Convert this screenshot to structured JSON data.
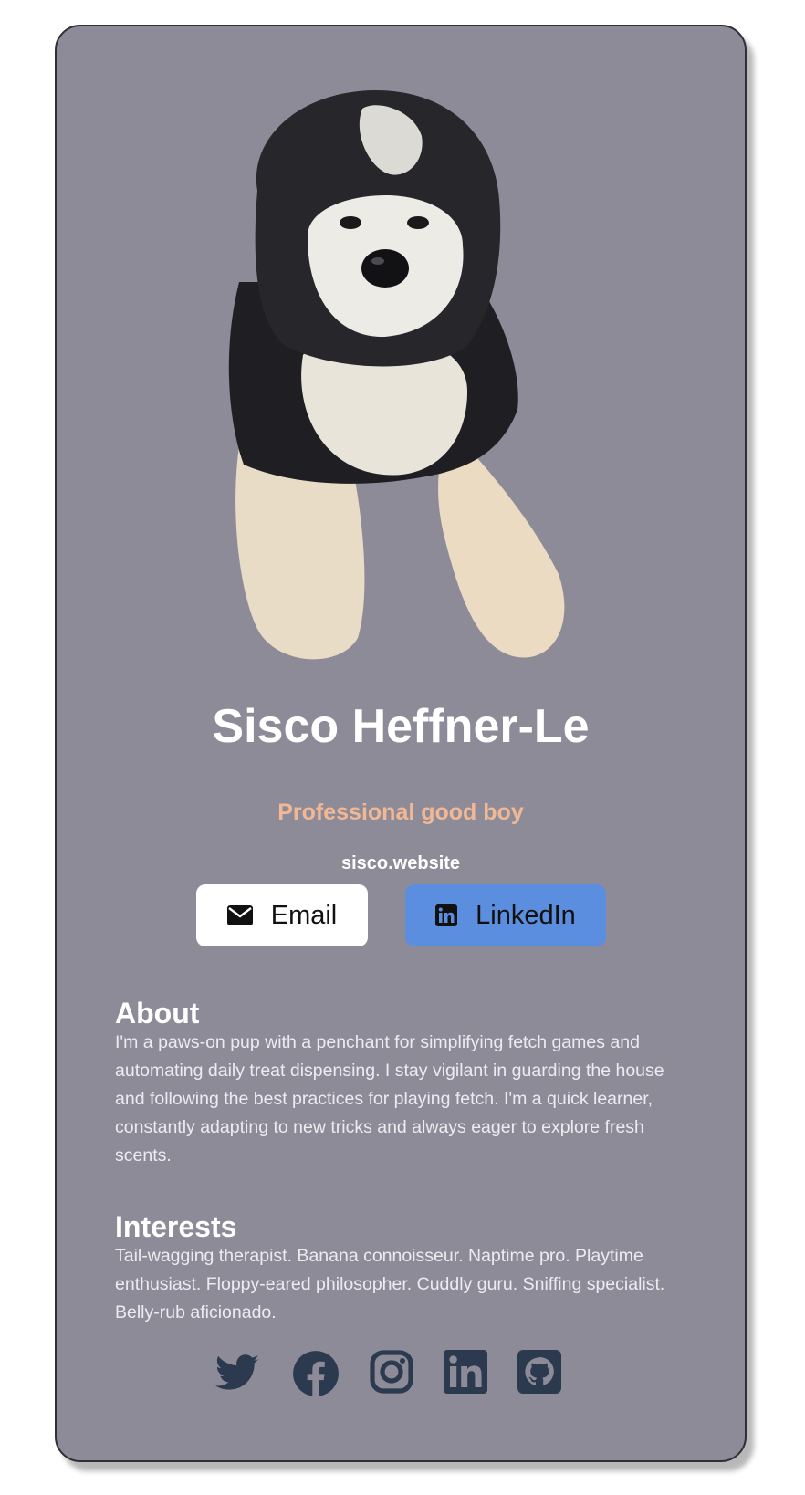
{
  "profile": {
    "name": "Sisco Heffner-Le",
    "tagline": "Professional good boy",
    "website": "sisco.website",
    "photo_alt": "dog-photo"
  },
  "buttons": {
    "email_label": "Email",
    "linkedin_label": "LinkedIn"
  },
  "about": {
    "title": "About",
    "text": "I'm a paws-on pup with a penchant for simplifying fetch games and automating daily treat dispensing. I stay vigilant in guarding the house and following the best practices for playing fetch. I'm a quick learner, constantly adapting to new tricks and always eager to explore fresh scents."
  },
  "interests": {
    "title": "Interests",
    "text": "Tail-wagging therapist. Banana connoisseur. Naptime pro. Playtime enthusiast. Floppy-eared philosopher. Cuddly guru. Sniffing specialist. Belly-rub aficionado."
  },
  "social": {
    "icons": [
      "twitter-icon",
      "facebook-icon",
      "instagram-icon",
      "linkedin-icon",
      "github-icon"
    ]
  },
  "colors": {
    "page_background": "#ffffff",
    "card_background": "#8e8b98",
    "card_border": "#2f2f35",
    "tagline": "#f0b895",
    "linkedin_button": "#5b8ede",
    "email_button": "#ffffff",
    "social_icons": "#2b3a4e"
  }
}
